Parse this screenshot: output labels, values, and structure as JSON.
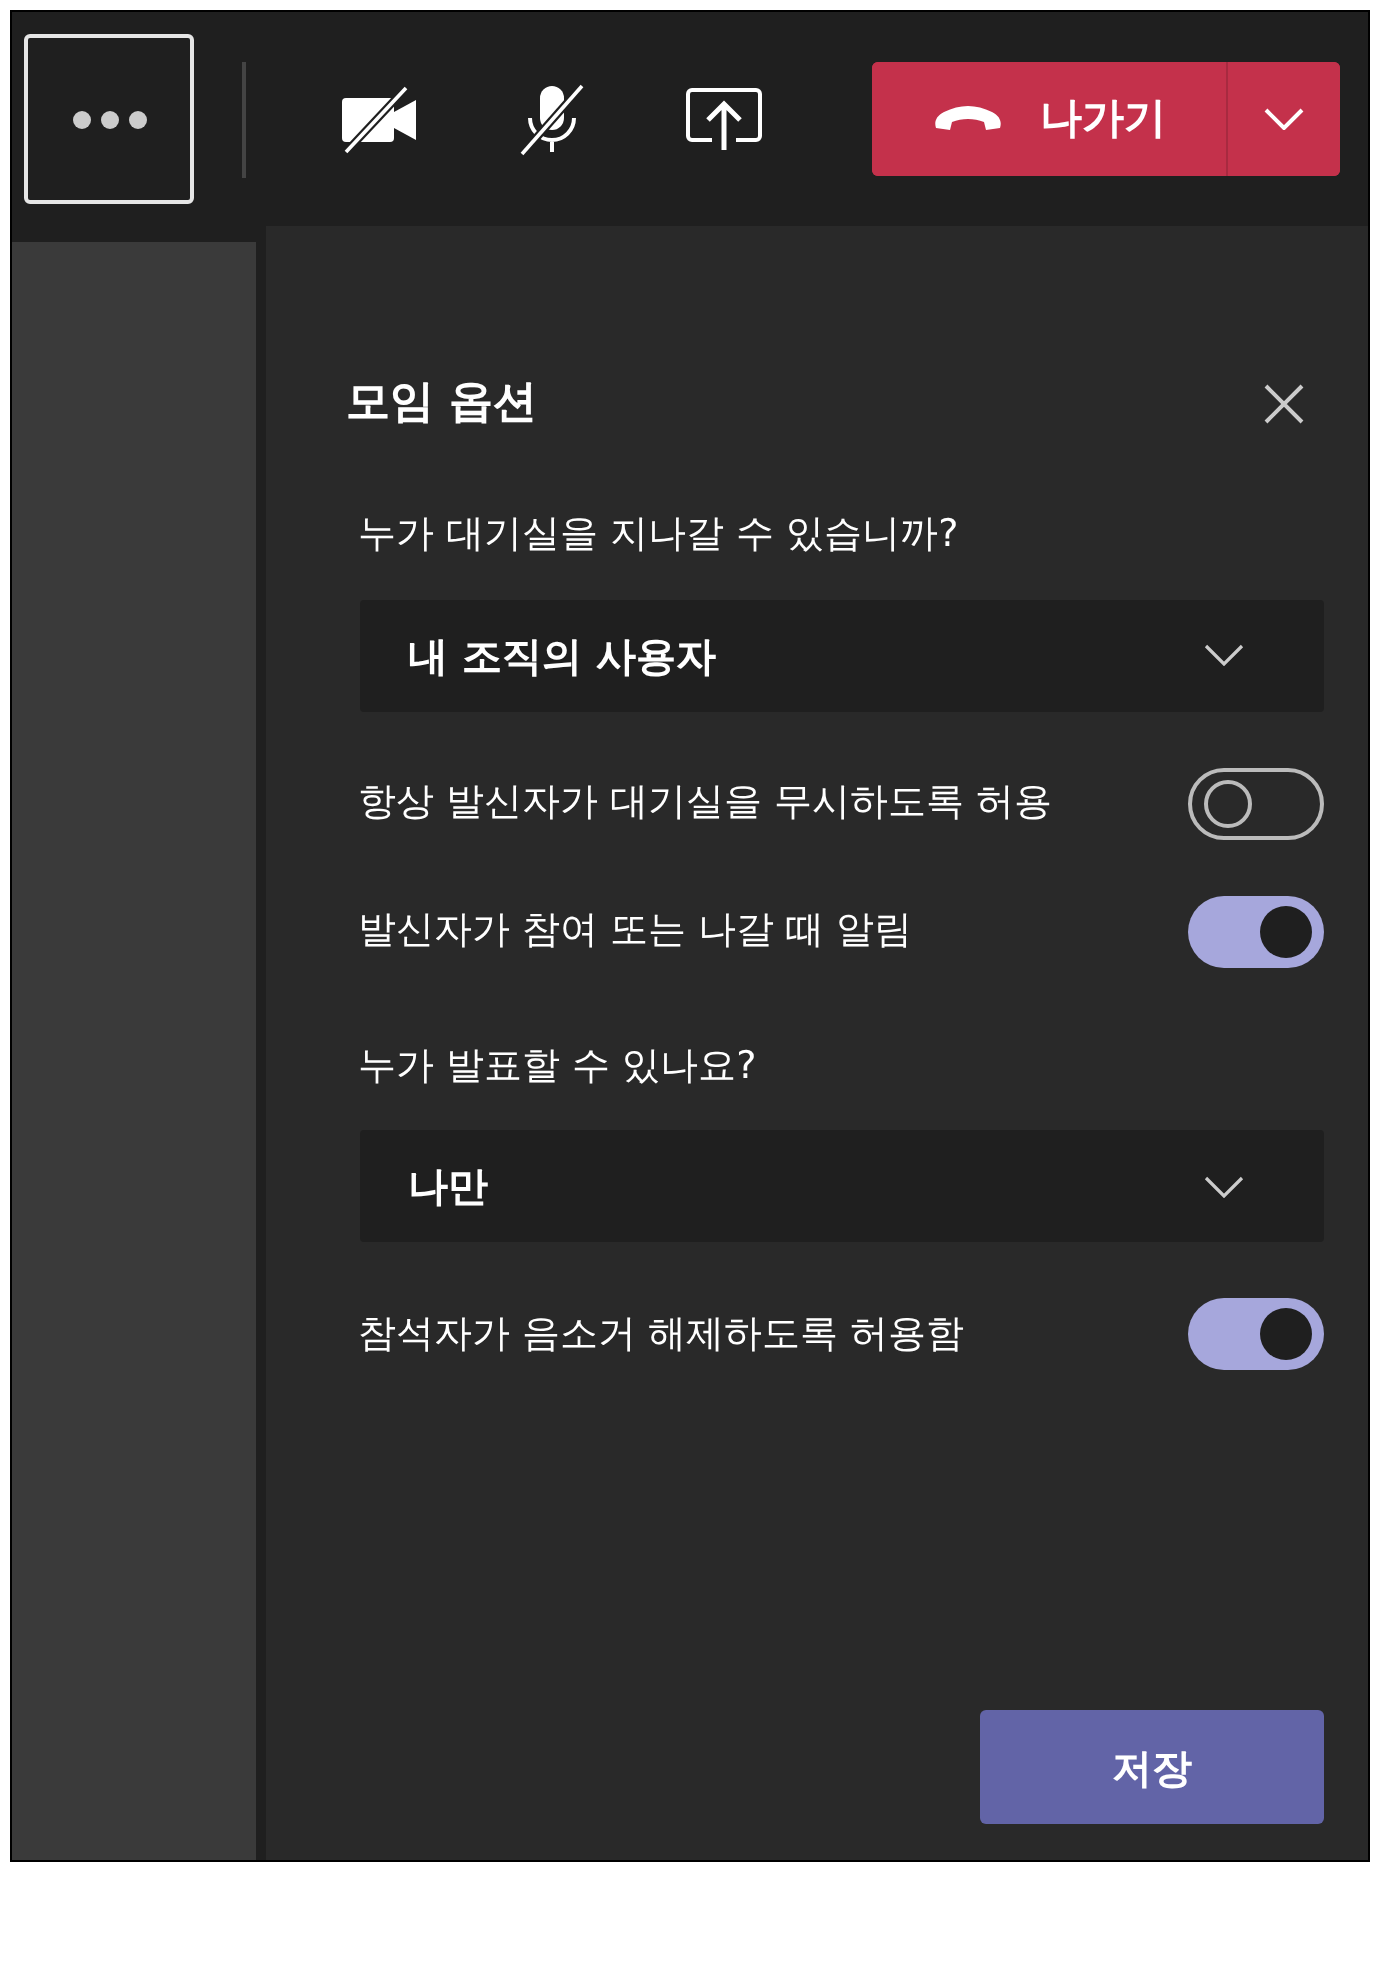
{
  "toolbar": {
    "leave_button": {
      "label": "나가기"
    }
  },
  "panel": {
    "title": "모임 옵션",
    "settings": [
      {
        "kind": "label",
        "text": "누가 대기실을 지나갈 수 있습니까?"
      },
      {
        "kind": "select",
        "value": "내 조직의 사용자"
      },
      {
        "kind": "toggle",
        "text": "항상 발신자가 대기실을 무시하도록 허용",
        "on": false
      },
      {
        "kind": "toggle",
        "text": "발신자가 참여 또는 나갈 때 알림",
        "on": true
      },
      {
        "kind": "label",
        "text": "누가 발표할 수 있나요?"
      },
      {
        "kind": "select",
        "value": "나만"
      },
      {
        "kind": "toggle",
        "text": "참석자가 음소거 해제하도록 허용함",
        "on": true
      }
    ],
    "save_button": "저장"
  }
}
